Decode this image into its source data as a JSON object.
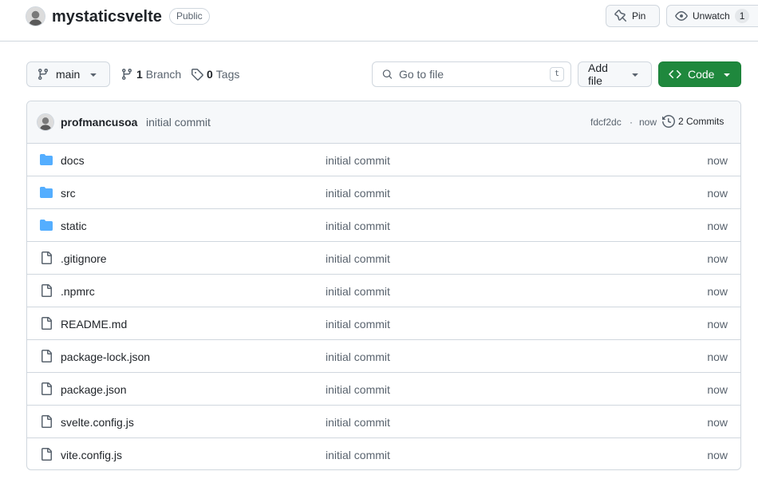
{
  "repo": {
    "name": "mystaticsvelte",
    "visibility": "Public",
    "pin_label": "Pin",
    "watch_label": "Unwatch",
    "watch_count": "1"
  },
  "toolbar": {
    "branch": "main",
    "branch_count": "1",
    "branch_label": "Branch",
    "tag_count": "0",
    "tag_label": "Tags",
    "goto_placeholder": "Go to file",
    "goto_shortcut": "t",
    "add_file_label": "Add file",
    "code_label": "Code"
  },
  "latest_commit": {
    "author": "profmancusoa",
    "message": "initial commit",
    "sha": "fdcf2dc",
    "separator": "·",
    "time": "now",
    "commits_label": "2 Commits"
  },
  "files": [
    {
      "name": "docs",
      "type": "dir",
      "message": "initial commit",
      "time": "now"
    },
    {
      "name": "src",
      "type": "dir",
      "message": "initial commit",
      "time": "now"
    },
    {
      "name": "static",
      "type": "dir",
      "message": "initial commit",
      "time": "now"
    },
    {
      "name": ".gitignore",
      "type": "file",
      "message": "initial commit",
      "time": "now"
    },
    {
      "name": ".npmrc",
      "type": "file",
      "message": "initial commit",
      "time": "now"
    },
    {
      "name": "README.md",
      "type": "file",
      "message": "initial commit",
      "time": "now"
    },
    {
      "name": "package-lock.json",
      "type": "file",
      "message": "initial commit",
      "time": "now"
    },
    {
      "name": "package.json",
      "type": "file",
      "message": "initial commit",
      "time": "now"
    },
    {
      "name": "svelte.config.js",
      "type": "file",
      "message": "initial commit",
      "time": "now"
    },
    {
      "name": "vite.config.js",
      "type": "file",
      "message": "initial commit",
      "time": "now"
    }
  ],
  "colors": {
    "accent_green": "#1f883d",
    "folder_blue": "#54aeff",
    "muted_text": "#59636e",
    "border": "#d0d7de"
  },
  "icons": {
    "directory": "folder-icon",
    "file": "file-icon"
  }
}
